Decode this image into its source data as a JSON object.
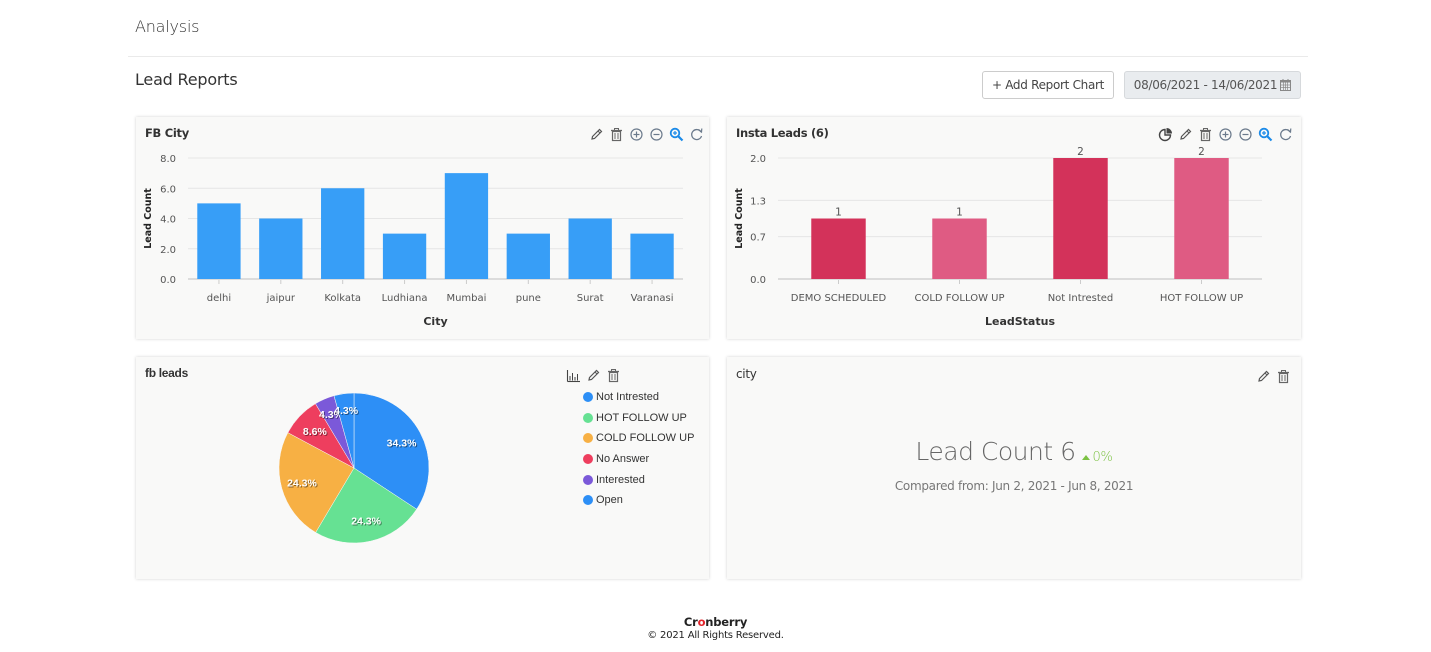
{
  "header": {
    "title": "Analysis",
    "section_title": "Lead Reports",
    "add_button_label": "+ Add Report Chart",
    "date_range": "08/06/2021 - 14/06/2021",
    "date_icon": "calendar-icon"
  },
  "cards": {
    "fb_city": {
      "title": "FB City",
      "toolbar": [
        "edit-icon",
        "delete-icon",
        "zoom-in-circle-icon",
        "zoom-out-circle-icon",
        "magnify-zoom-icon",
        "reset-icon"
      ]
    },
    "insta_leads": {
      "title": "Insta Leads (6)",
      "toolbar": [
        "pie-chart-icon",
        "edit-icon",
        "delete-icon",
        "zoom-in-circle-icon",
        "zoom-out-circle-icon",
        "magnify-zoom-icon",
        "reset-icon"
      ]
    },
    "fb_leads": {
      "title": "fb leads",
      "toolbar": [
        "bar-chart-icon",
        "edit-icon",
        "delete-icon"
      ]
    },
    "city": {
      "title": "city",
      "toolbar": [
        "edit-icon",
        "delete-icon"
      ],
      "kpi_label": "Lead Count 6",
      "kpi_change": "0%",
      "kpi_change_direction": "up",
      "kpi_change_color": "#7cc243",
      "compared_text": "Compared from: Jun 2, 2021 - Jun 8, 2021"
    }
  },
  "footer": {
    "brand_pre": "Cr",
    "brand_accent": "o",
    "brand_post": "nberry",
    "copyright": "© 2021 All Rights Reserved."
  },
  "chart_data": [
    {
      "id": "fb_city",
      "type": "bar",
      "title": "FB City",
      "xlabel": "City",
      "ylabel": "Lead Count",
      "categories": [
        "delhi",
        "jaipur",
        "Kolkata",
        "Ludhiana",
        "Mumbai",
        "pune",
        "Surat",
        "Varanasi"
      ],
      "values": [
        5,
        4,
        6,
        3,
        7,
        3,
        4,
        3
      ],
      "yticks": [
        "0.0",
        "2.0",
        "4.0",
        "6.0",
        "8.0"
      ],
      "ylim": [
        0,
        8
      ],
      "grid": true,
      "color": "#379ef7"
    },
    {
      "id": "insta_leads",
      "type": "bar",
      "title": "Insta Leads (6)",
      "xlabel": "LeadStatus",
      "ylabel": "Lead Count",
      "categories": [
        "DEMO SCHEDULED",
        "COLD FOLLOW UP",
        "Not Intrested",
        "HOT FOLLOW UP"
      ],
      "values": [
        1,
        1,
        2,
        2
      ],
      "data_labels": [
        "1",
        "1",
        "2",
        "2"
      ],
      "yticks": [
        "0.0",
        "0.7",
        "1.3",
        "2.0"
      ],
      "ylim": [
        0,
        2
      ],
      "grid": true,
      "colors": [
        "#d3325a",
        "#df5b83",
        "#d3325a",
        "#df5b83"
      ]
    },
    {
      "id": "fb_leads",
      "type": "pie",
      "title": "fb leads",
      "legend_position": "right",
      "slices": [
        {
          "label": "Not Intrested",
          "value": 34.3,
          "display": "34.3%",
          "color": "#2d8ff6"
        },
        {
          "label": "HOT FOLLOW UP",
          "value": 24.3,
          "display": "24.3%",
          "color": "#66e193"
        },
        {
          "label": "COLD FOLLOW UP",
          "value": 24.3,
          "display": "24.3%",
          "color": "#f7b044"
        },
        {
          "label": "No Answer",
          "value": 8.6,
          "display": "8.6%",
          "color": "#ee3e5e"
        },
        {
          "label": "Interested",
          "value": 4.3,
          "display": "4.3%",
          "color": "#7b59d9"
        },
        {
          "label": "Open",
          "value": 4.3,
          "display": "4.3%",
          "color": "#2d8ff6"
        }
      ]
    }
  ]
}
